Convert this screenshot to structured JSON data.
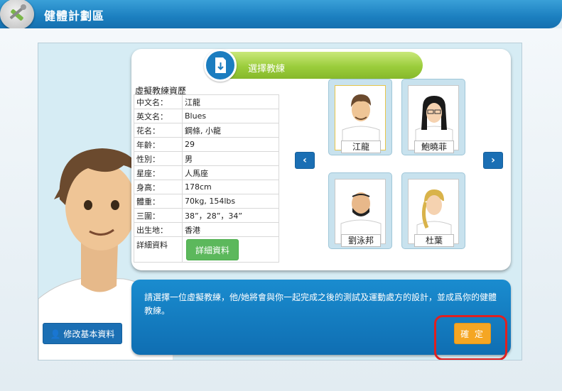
{
  "header": {
    "title": "健體計劃區",
    "logo_icon": "tools-icon"
  },
  "card": {
    "tab_title": "選擇教練",
    "tab_icon": "download-document-icon",
    "info_title": "虛擬教練資歷",
    "rows": [
      {
        "key": "中文名：",
        "value": "江龍"
      },
      {
        "key": "英文名：",
        "value": "Blues"
      },
      {
        "key": "花名：",
        "value": "鋼條, 小龍"
      },
      {
        "key": "年齡：",
        "value": "29"
      },
      {
        "key": "性別：",
        "value": "男"
      },
      {
        "key": "星座：",
        "value": "人馬座"
      },
      {
        "key": "身高：",
        "value": "178cm"
      },
      {
        "key": "體重：",
        "value": "70kg, 154lbs"
      },
      {
        "key": "三圍：",
        "value": "38”，28”，34”"
      },
      {
        "key": "出生地：",
        "value": "香港"
      }
    ],
    "detail_key": "詳細資料",
    "detail_button": "詳細資料"
  },
  "carousel": {
    "prev_label": "‹",
    "next_label": "›",
    "coaches": [
      {
        "name": "江龍",
        "selected": true
      },
      {
        "name": "鮑曉菲",
        "selected": false
      },
      {
        "name": "劉泳邦",
        "selected": false
      },
      {
        "name": "杜葉",
        "selected": false
      }
    ]
  },
  "panel": {
    "text": "請選擇一位虛擬教練，他/她將會與你一起完成之後的測試及運動處方的設計，並成爲你的健體教練。",
    "confirm_label": "確 定"
  },
  "edit_button": "修改基本資料",
  "colors": {
    "header_blue": "#1b7fc0",
    "tab_green": "#9bcd3c",
    "confirm_orange": "#f5a623",
    "highlight_red": "#e02020"
  }
}
